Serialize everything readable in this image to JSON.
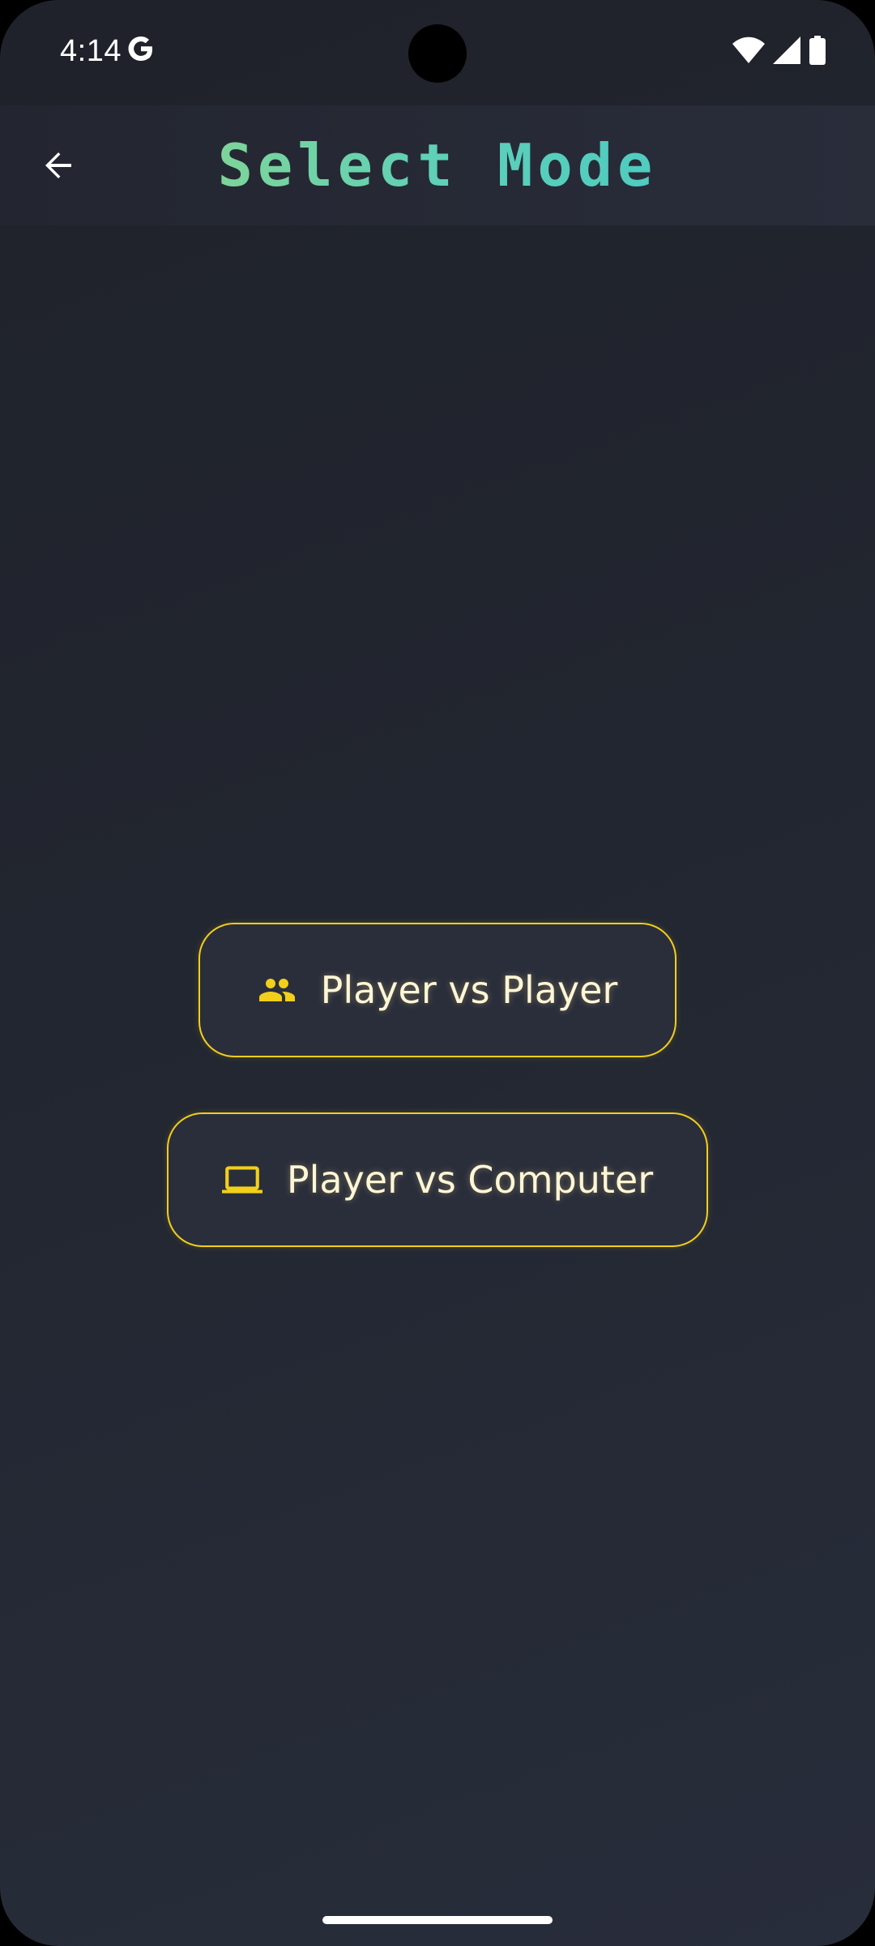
{
  "status_bar": {
    "time": "4:14",
    "icons": [
      "google-g-icon",
      "wifi-icon",
      "signal-icon",
      "battery-icon"
    ]
  },
  "app_bar": {
    "title": "Select Mode",
    "back_icon": "arrow-back-icon",
    "title_gradient": [
      "#9bd97a",
      "#3fc7c8"
    ]
  },
  "modes": [
    {
      "label": "Player vs Player",
      "icon": "people-icon"
    },
    {
      "label": "Player vs Computer",
      "icon": "laptop-icon"
    }
  ],
  "colors": {
    "accent": "#f2cf1a",
    "background": "#222630",
    "button_fill": "#2a2e3b",
    "button_text": "#fff6d6"
  }
}
